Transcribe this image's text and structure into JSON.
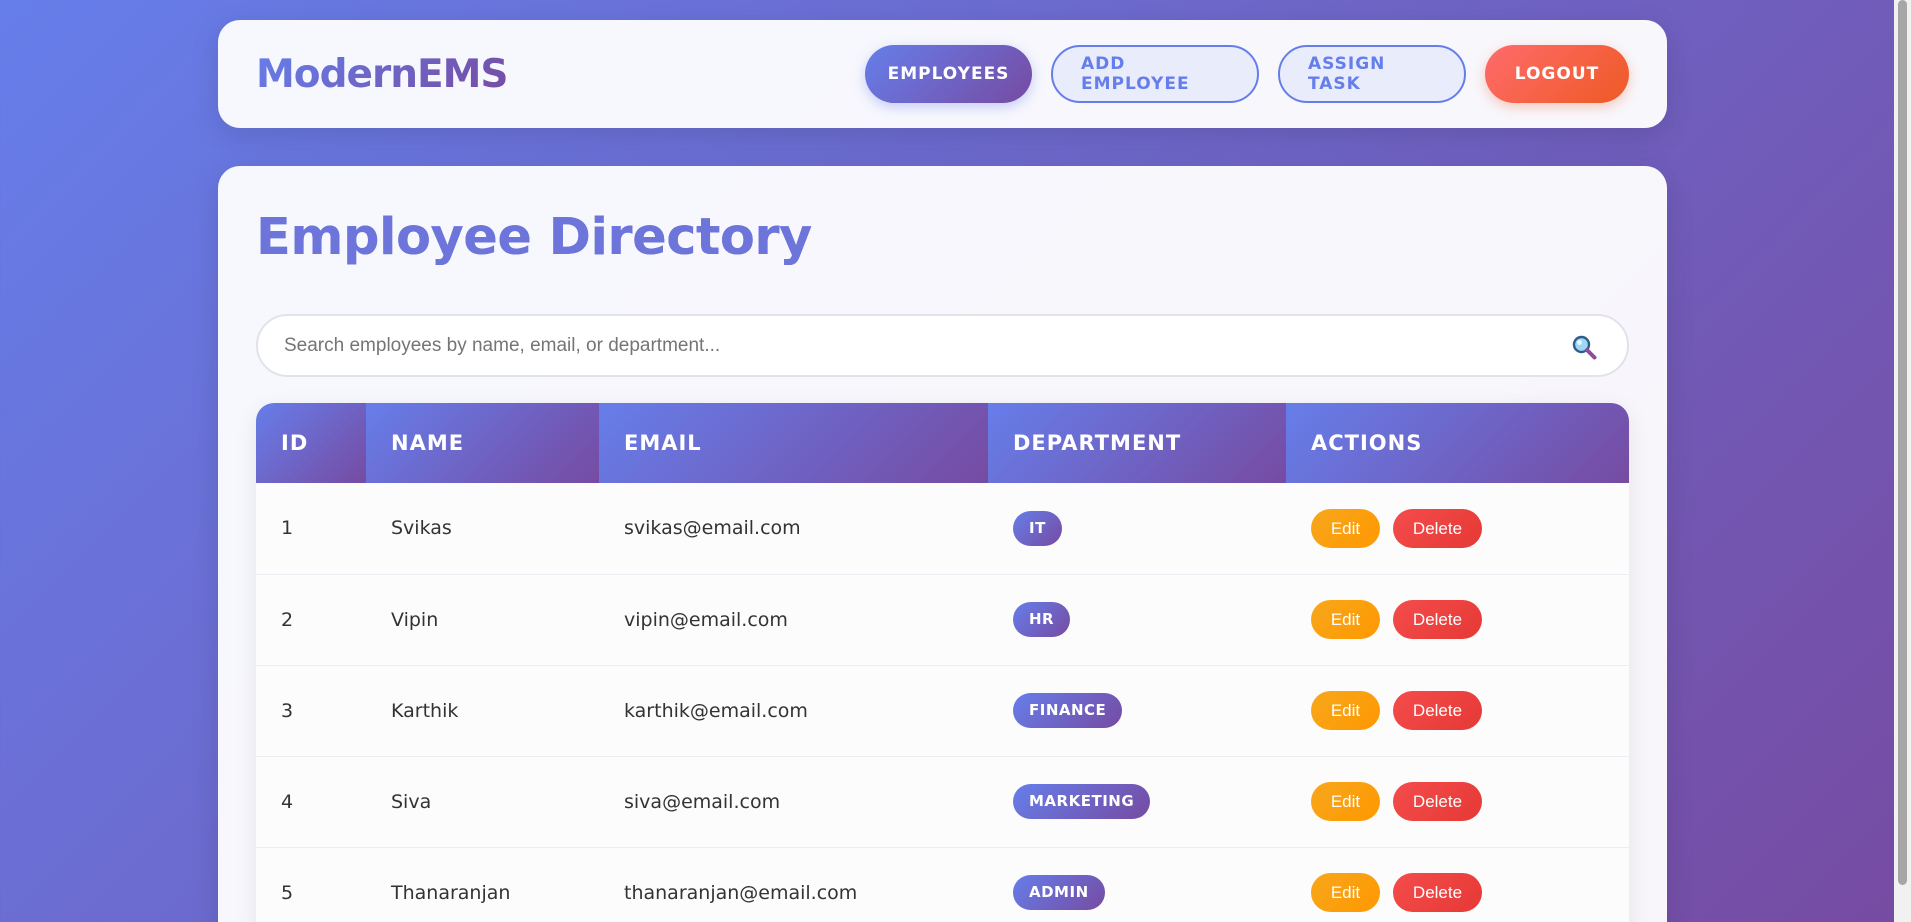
{
  "app": {
    "logo": "ModernEMS"
  },
  "nav": {
    "employees": "EMPLOYEES",
    "add_employee": "ADD EMPLOYEE",
    "assign_task": "ASSIGN TASK",
    "logout": "LOGOUT"
  },
  "page": {
    "title": "Employee Directory"
  },
  "search": {
    "placeholder": "Search employees by name, email, or department...",
    "value": "",
    "icon": "magnifier-icon"
  },
  "table": {
    "columns": [
      "ID",
      "NAME",
      "EMAIL",
      "DEPARTMENT",
      "ACTIONS"
    ],
    "rows": [
      {
        "id": "1",
        "name": "Svikas",
        "email": "svikas@email.com",
        "department": "IT",
        "edit": "Edit",
        "delete": "Delete"
      },
      {
        "id": "2",
        "name": "Vipin",
        "email": "vipin@email.com",
        "department": "HR",
        "edit": "Edit",
        "delete": "Delete"
      },
      {
        "id": "3",
        "name": "Karthik",
        "email": "karthik@email.com",
        "department": "FINANCE",
        "edit": "Edit",
        "delete": "Delete"
      },
      {
        "id": "4",
        "name": "Siva",
        "email": "siva@email.com",
        "department": "MARKETING",
        "edit": "Edit",
        "delete": "Delete"
      },
      {
        "id": "5",
        "name": "Thanaranjan",
        "email": "thanaranjan@email.com",
        "department": "ADMIN",
        "edit": "Edit",
        "delete": "Delete"
      }
    ]
  },
  "colors": {
    "gradient_start": "#667eea",
    "gradient_end": "#764ba2",
    "logout": "#ee5a24",
    "edit": "#ff9800",
    "delete": "#e53935"
  }
}
